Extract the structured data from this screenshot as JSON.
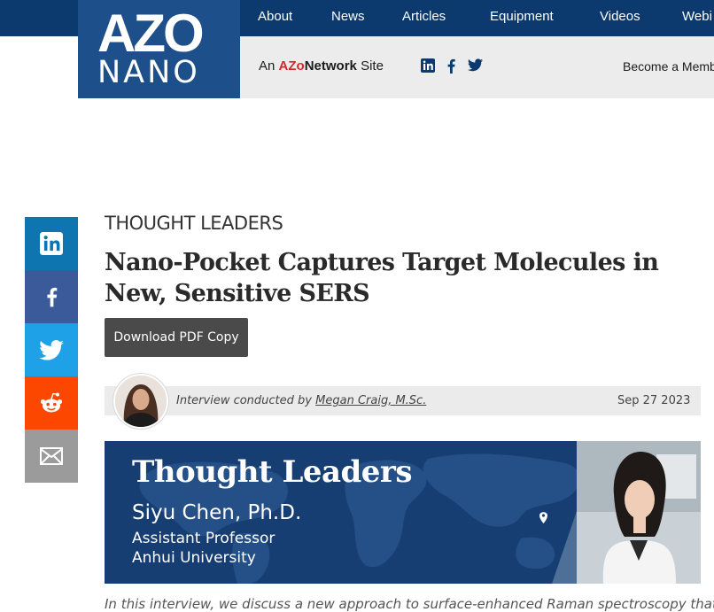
{
  "header": {
    "logo": {
      "top": "AZO",
      "bottom": "NANO"
    },
    "nav": [
      "About",
      "News",
      "Articles",
      "Equipment",
      "Videos",
      "Webi"
    ],
    "network": {
      "prefix": "An",
      "brand_az": "AZo",
      "brand_rest": "Network",
      "suffix": "Site"
    },
    "social_icons": [
      "linkedin-icon",
      "facebook-icon",
      "twitter-icon"
    ],
    "become_member": "Become a Memb"
  },
  "share_sidebar": {
    "items": [
      {
        "name": "linkedin",
        "color": "#0f75b1"
      },
      {
        "name": "facebook",
        "color": "#3a5a99"
      },
      {
        "name": "twitter",
        "color": "#1ea1e6"
      },
      {
        "name": "reddit",
        "color": "#fb4700"
      },
      {
        "name": "email",
        "color": "#9b9b9b"
      }
    ]
  },
  "article": {
    "kicker": "THOUGHT LEADERS",
    "title_line1": "Nano-Pocket Captures Target Molecules in",
    "title_line2": "New, Sensitive SERS",
    "download_label": "Download PDF Copy",
    "byline_prefix": "Interview conducted by",
    "author": "Megan Craig, M.Sc.",
    "date": "Sep 27 2023",
    "intro": "In this interview, we discuss a new approach to surface-enhanced Raman spectroscopy that"
  },
  "banner": {
    "heading": "Thought Leaders",
    "name": "Siyu Chen, Ph.D.",
    "role": "Assistant Professor",
    "organization": "Anhui University"
  },
  "colors": {
    "topbar": "#0c3a6e",
    "logo_bg": "#1d4f8a",
    "banner_bg": "#163e73",
    "button_bg": "#4a4a4a"
  }
}
